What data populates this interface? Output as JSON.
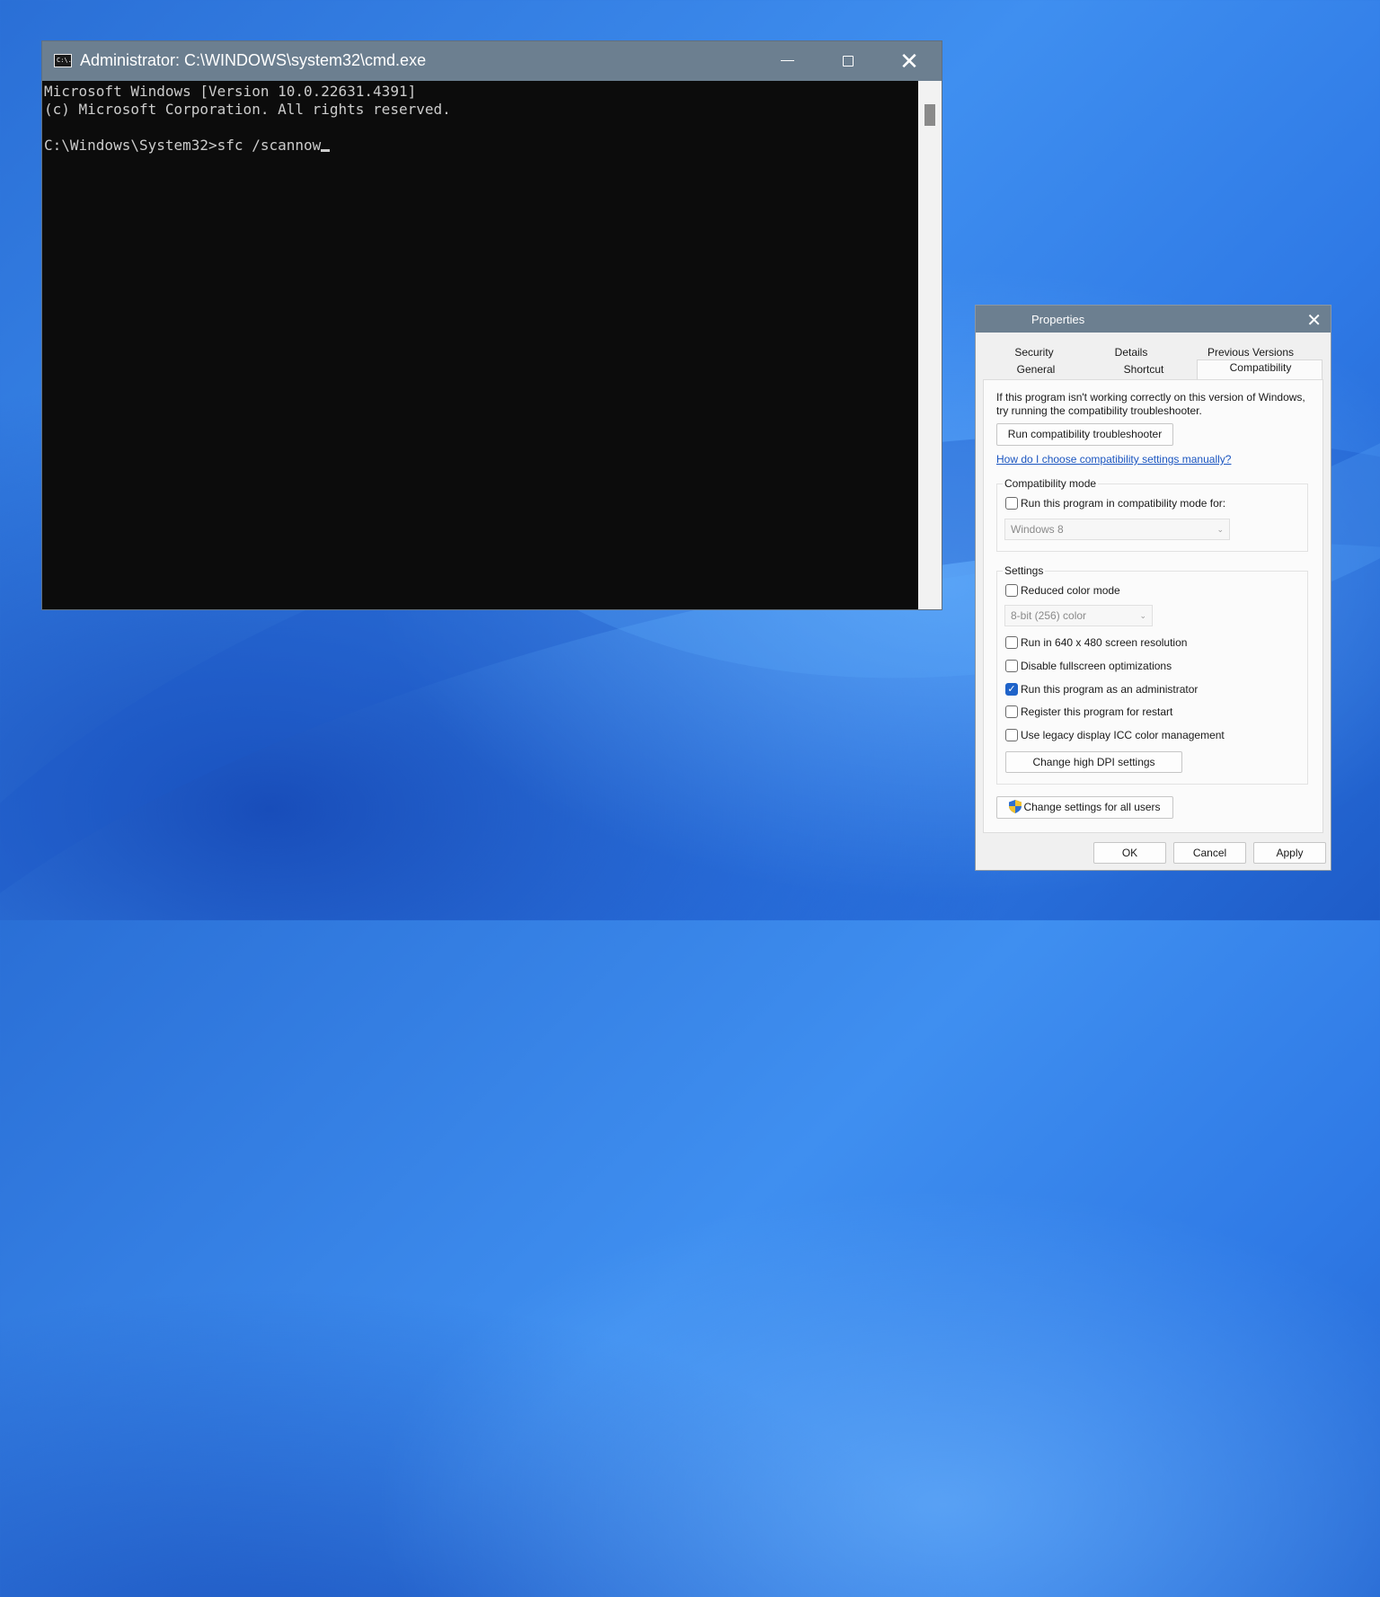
{
  "cmd": {
    "title": "Administrator: C:\\WINDOWS\\system32\\cmd.exe",
    "icon_label": "C:\\.",
    "lines": [
      "Microsoft Windows [Version 10.0.22631.4391]",
      "(c) Microsoft Corporation. All rights reserved.",
      "",
      "C:\\Windows\\System32>sfc /scannow"
    ],
    "icons": {
      "minimize": "minimize-icon",
      "maximize": "maximize-icon",
      "close": "close-icon"
    }
  },
  "properties": {
    "title": "Properties",
    "tabs_row1": [
      "Security",
      "Details",
      "Previous Versions"
    ],
    "tabs_row2": [
      "General",
      "Shortcut",
      "Compatibility"
    ],
    "active_tab": "Compatibility",
    "intro": "If this program isn't working correctly on this version of Windows, try running the compatibility troubleshooter.",
    "troubleshooter_button": "Run compatibility troubleshooter",
    "help_link": "How do I choose compatibility settings manually?",
    "compat_mode": {
      "heading": "Compatibility mode",
      "checkbox_label": "Run this program in compatibility mode for:",
      "checked": false,
      "selected_os": "Windows 8"
    },
    "settings": {
      "heading": "Settings",
      "reduced_color": {
        "label": "Reduced color mode",
        "checked": false
      },
      "color_select": "8-bit (256) color",
      "options": [
        {
          "label": "Run in 640 x 480 screen resolution",
          "checked": false
        },
        {
          "label": "Disable fullscreen optimizations",
          "checked": false
        },
        {
          "label": "Run this program as an administrator",
          "checked": true
        },
        {
          "label": "Register this program for restart",
          "checked": false
        },
        {
          "label": "Use legacy display ICC color management",
          "checked": false
        }
      ],
      "dpi_button": "Change high DPI settings"
    },
    "all_users_button": "Change settings for all users",
    "footer": {
      "ok": "OK",
      "cancel": "Cancel",
      "apply": "Apply"
    },
    "colors": {
      "accent": "#1f63c9",
      "titlebar": "#6c7f90",
      "link": "#1a55c0"
    }
  }
}
